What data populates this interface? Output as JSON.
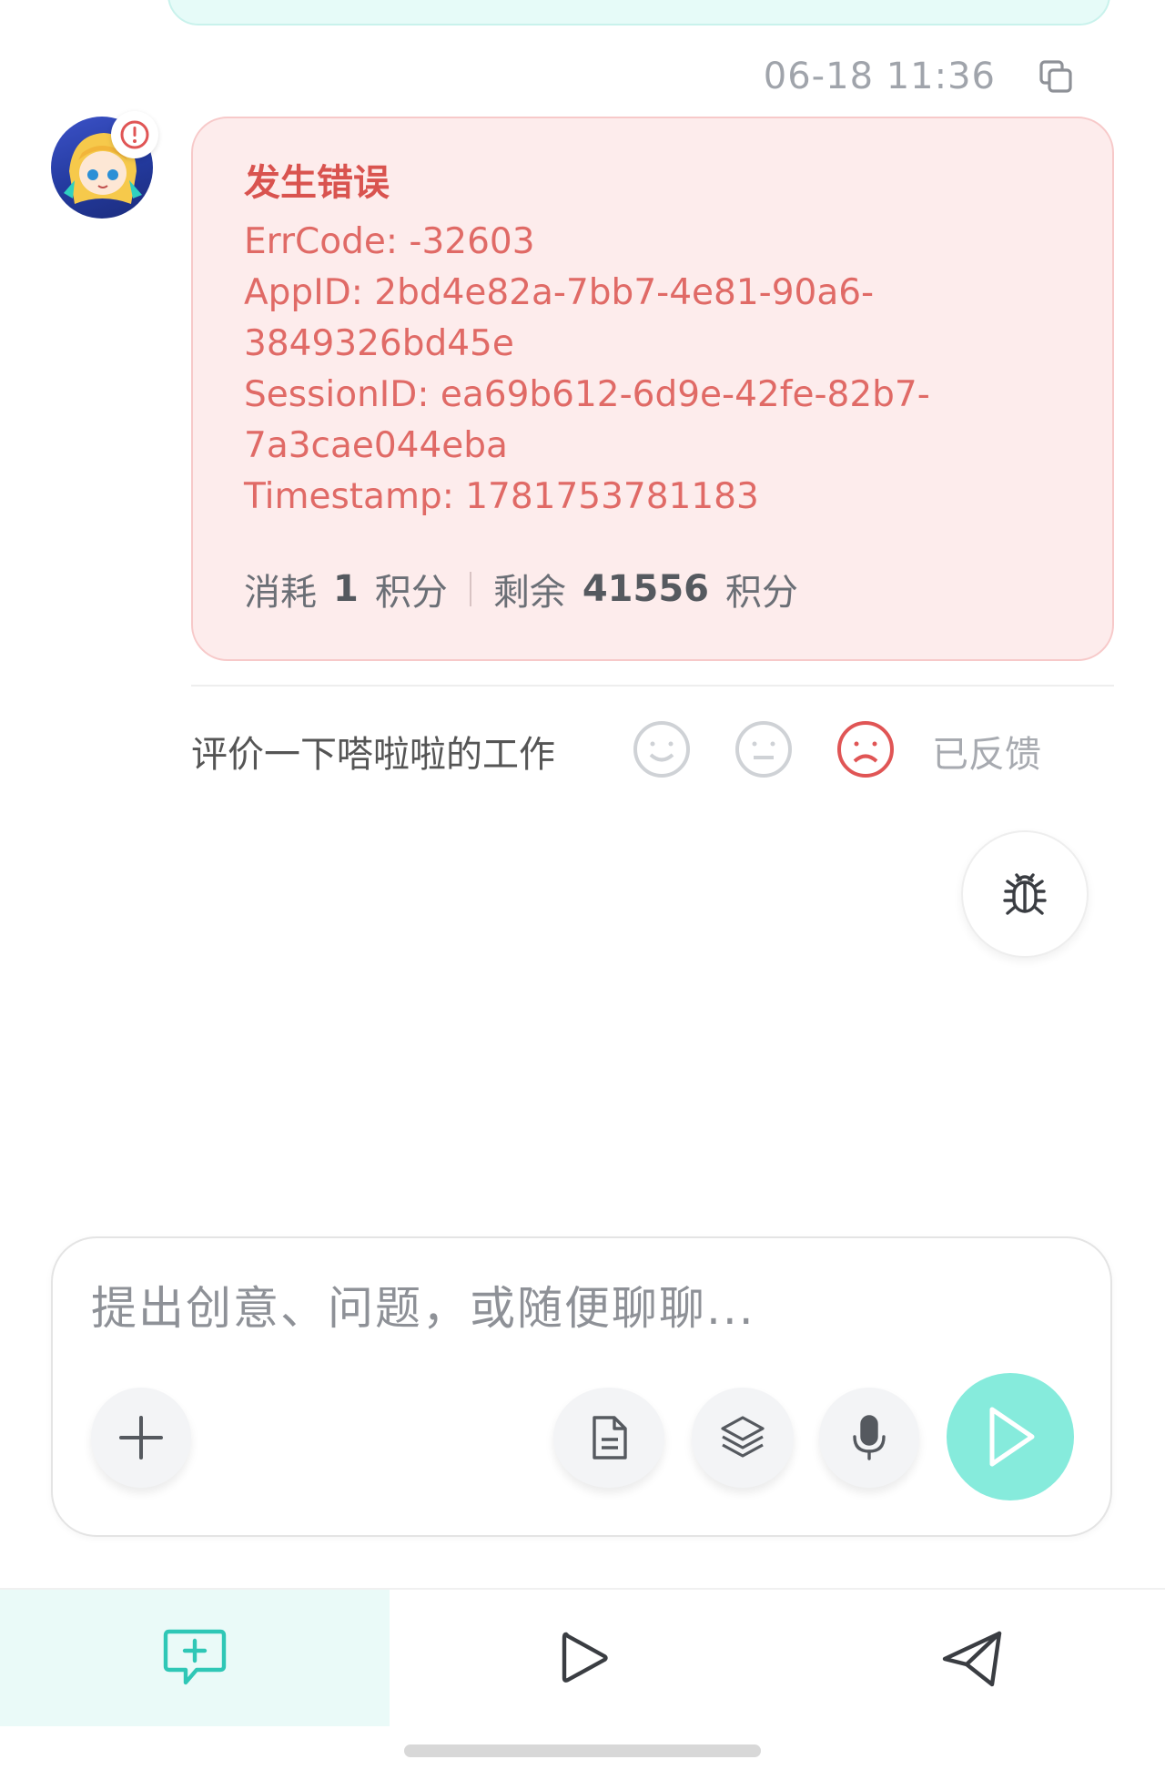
{
  "message": {
    "timestamp": "06-18 11:36",
    "error": {
      "title": "发生错误",
      "lines": [
        "ErrCode: -32603",
        "AppID: 2bd4e82a-7bb7-4e81-90a6-",
        "3849326bd45e",
        "SessionID: ea69b612-6d9e-42fe-82b7-",
        "7a3cae044eba",
        "Timestamp: 1781753781183"
      ]
    },
    "credits": {
      "consumed_prefix": "消耗",
      "consumed_value": "1",
      "consumed_unit": "积分",
      "remaining_prefix": "剩余",
      "remaining_value": "41556",
      "remaining_unit": "积分"
    }
  },
  "rating": {
    "label": "评价一下嗒啦啦的工作",
    "status": "已反馈",
    "selected": "sad",
    "colors": {
      "selected": "#e05555",
      "unselected": "#cfd2d6"
    }
  },
  "composer": {
    "placeholder": "提出创意、问题，或随便聊聊..."
  },
  "nav": {
    "items": [
      "chat-add",
      "play",
      "send"
    ],
    "active": "chat-add",
    "accent": "#2fc7b6"
  }
}
